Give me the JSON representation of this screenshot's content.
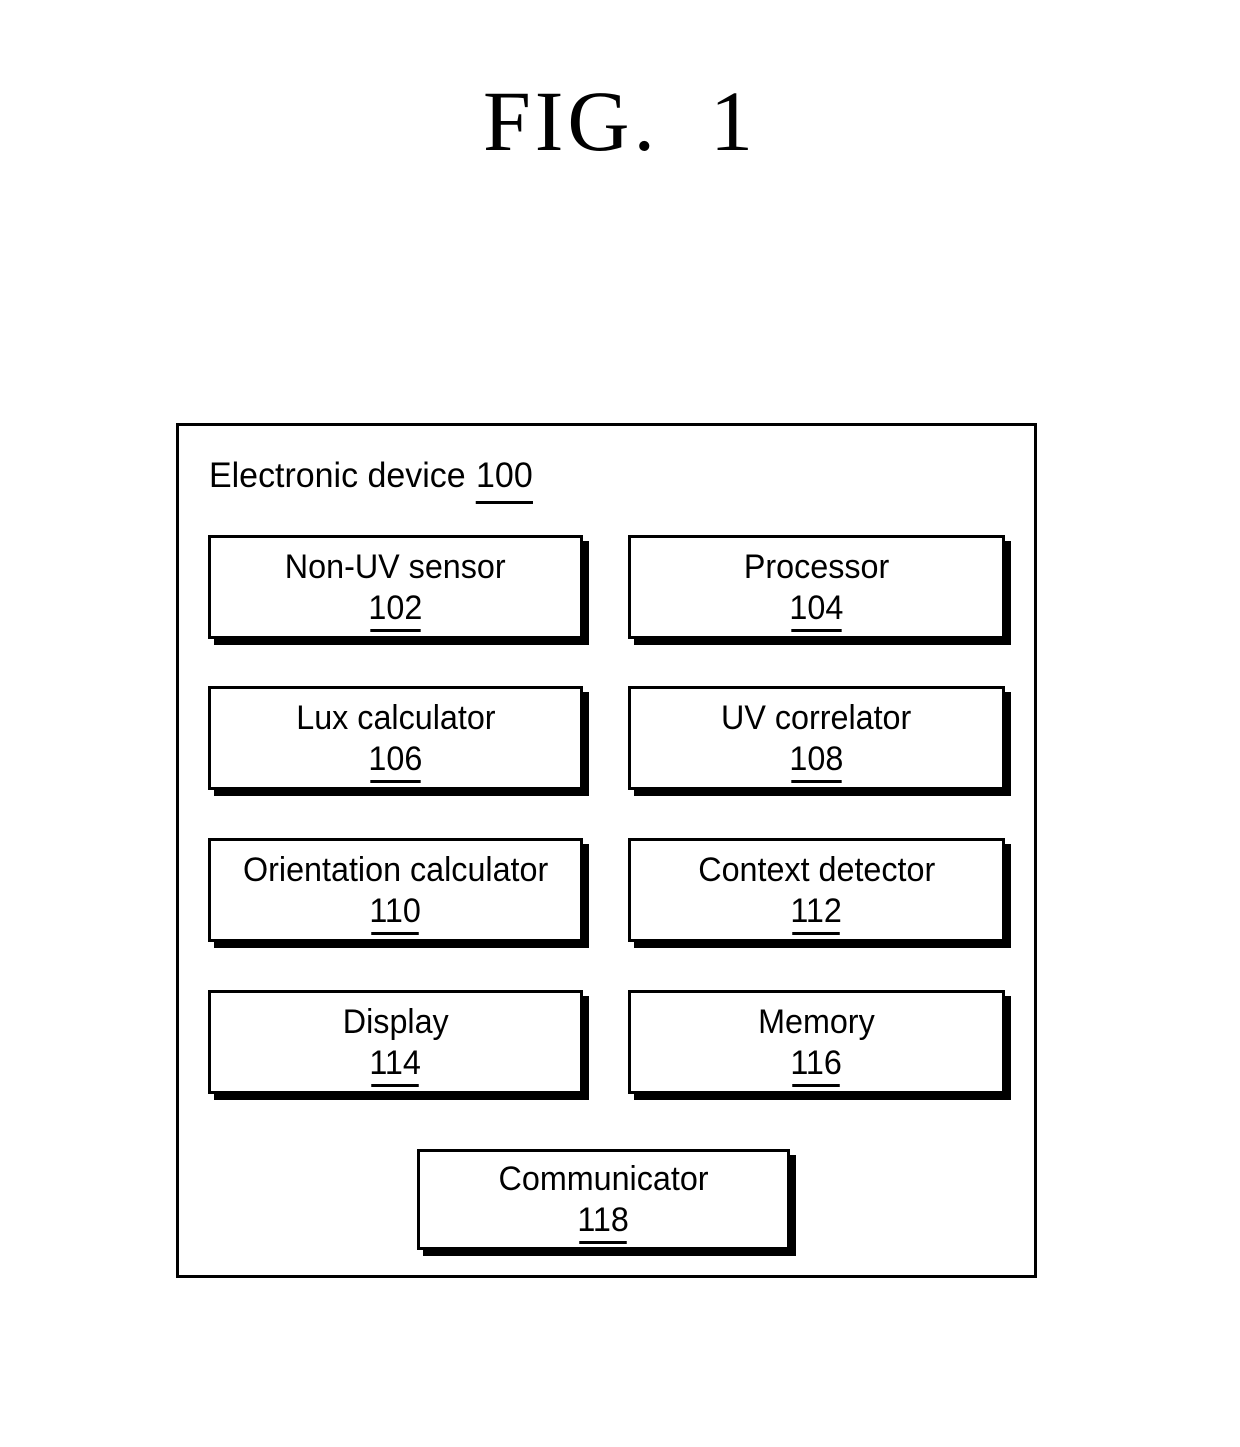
{
  "figure": {
    "title": "FIG.  1"
  },
  "diagram_data": {
    "type": "block-diagram",
    "container": {
      "label": "Electronic device",
      "reference_numeral": "100"
    },
    "blocks": [
      {
        "label": "Non-UV sensor",
        "reference_numeral": "102",
        "row": 1,
        "column": "left"
      },
      {
        "label": "Processor",
        "reference_numeral": "104",
        "row": 1,
        "column": "right"
      },
      {
        "label": "Lux calculator",
        "reference_numeral": "106",
        "row": 2,
        "column": "left"
      },
      {
        "label": "UV correlator",
        "reference_numeral": "108",
        "row": 2,
        "column": "right"
      },
      {
        "label": "Orientation calculator",
        "reference_numeral": "110",
        "row": 3,
        "column": "left"
      },
      {
        "label": "Context detector",
        "reference_numeral": "112",
        "row": 3,
        "column": "right"
      },
      {
        "label": "Display",
        "reference_numeral": "114",
        "row": 4,
        "column": "left"
      },
      {
        "label": "Memory",
        "reference_numeral": "116",
        "row": 4,
        "column": "right"
      },
      {
        "label": "Communicator",
        "reference_numeral": "118",
        "row": 5,
        "column": "center"
      }
    ],
    "colors": {
      "background": "#ffffff",
      "stroke": "#000000",
      "text": "#000000",
      "shadow": "#000000"
    }
  }
}
